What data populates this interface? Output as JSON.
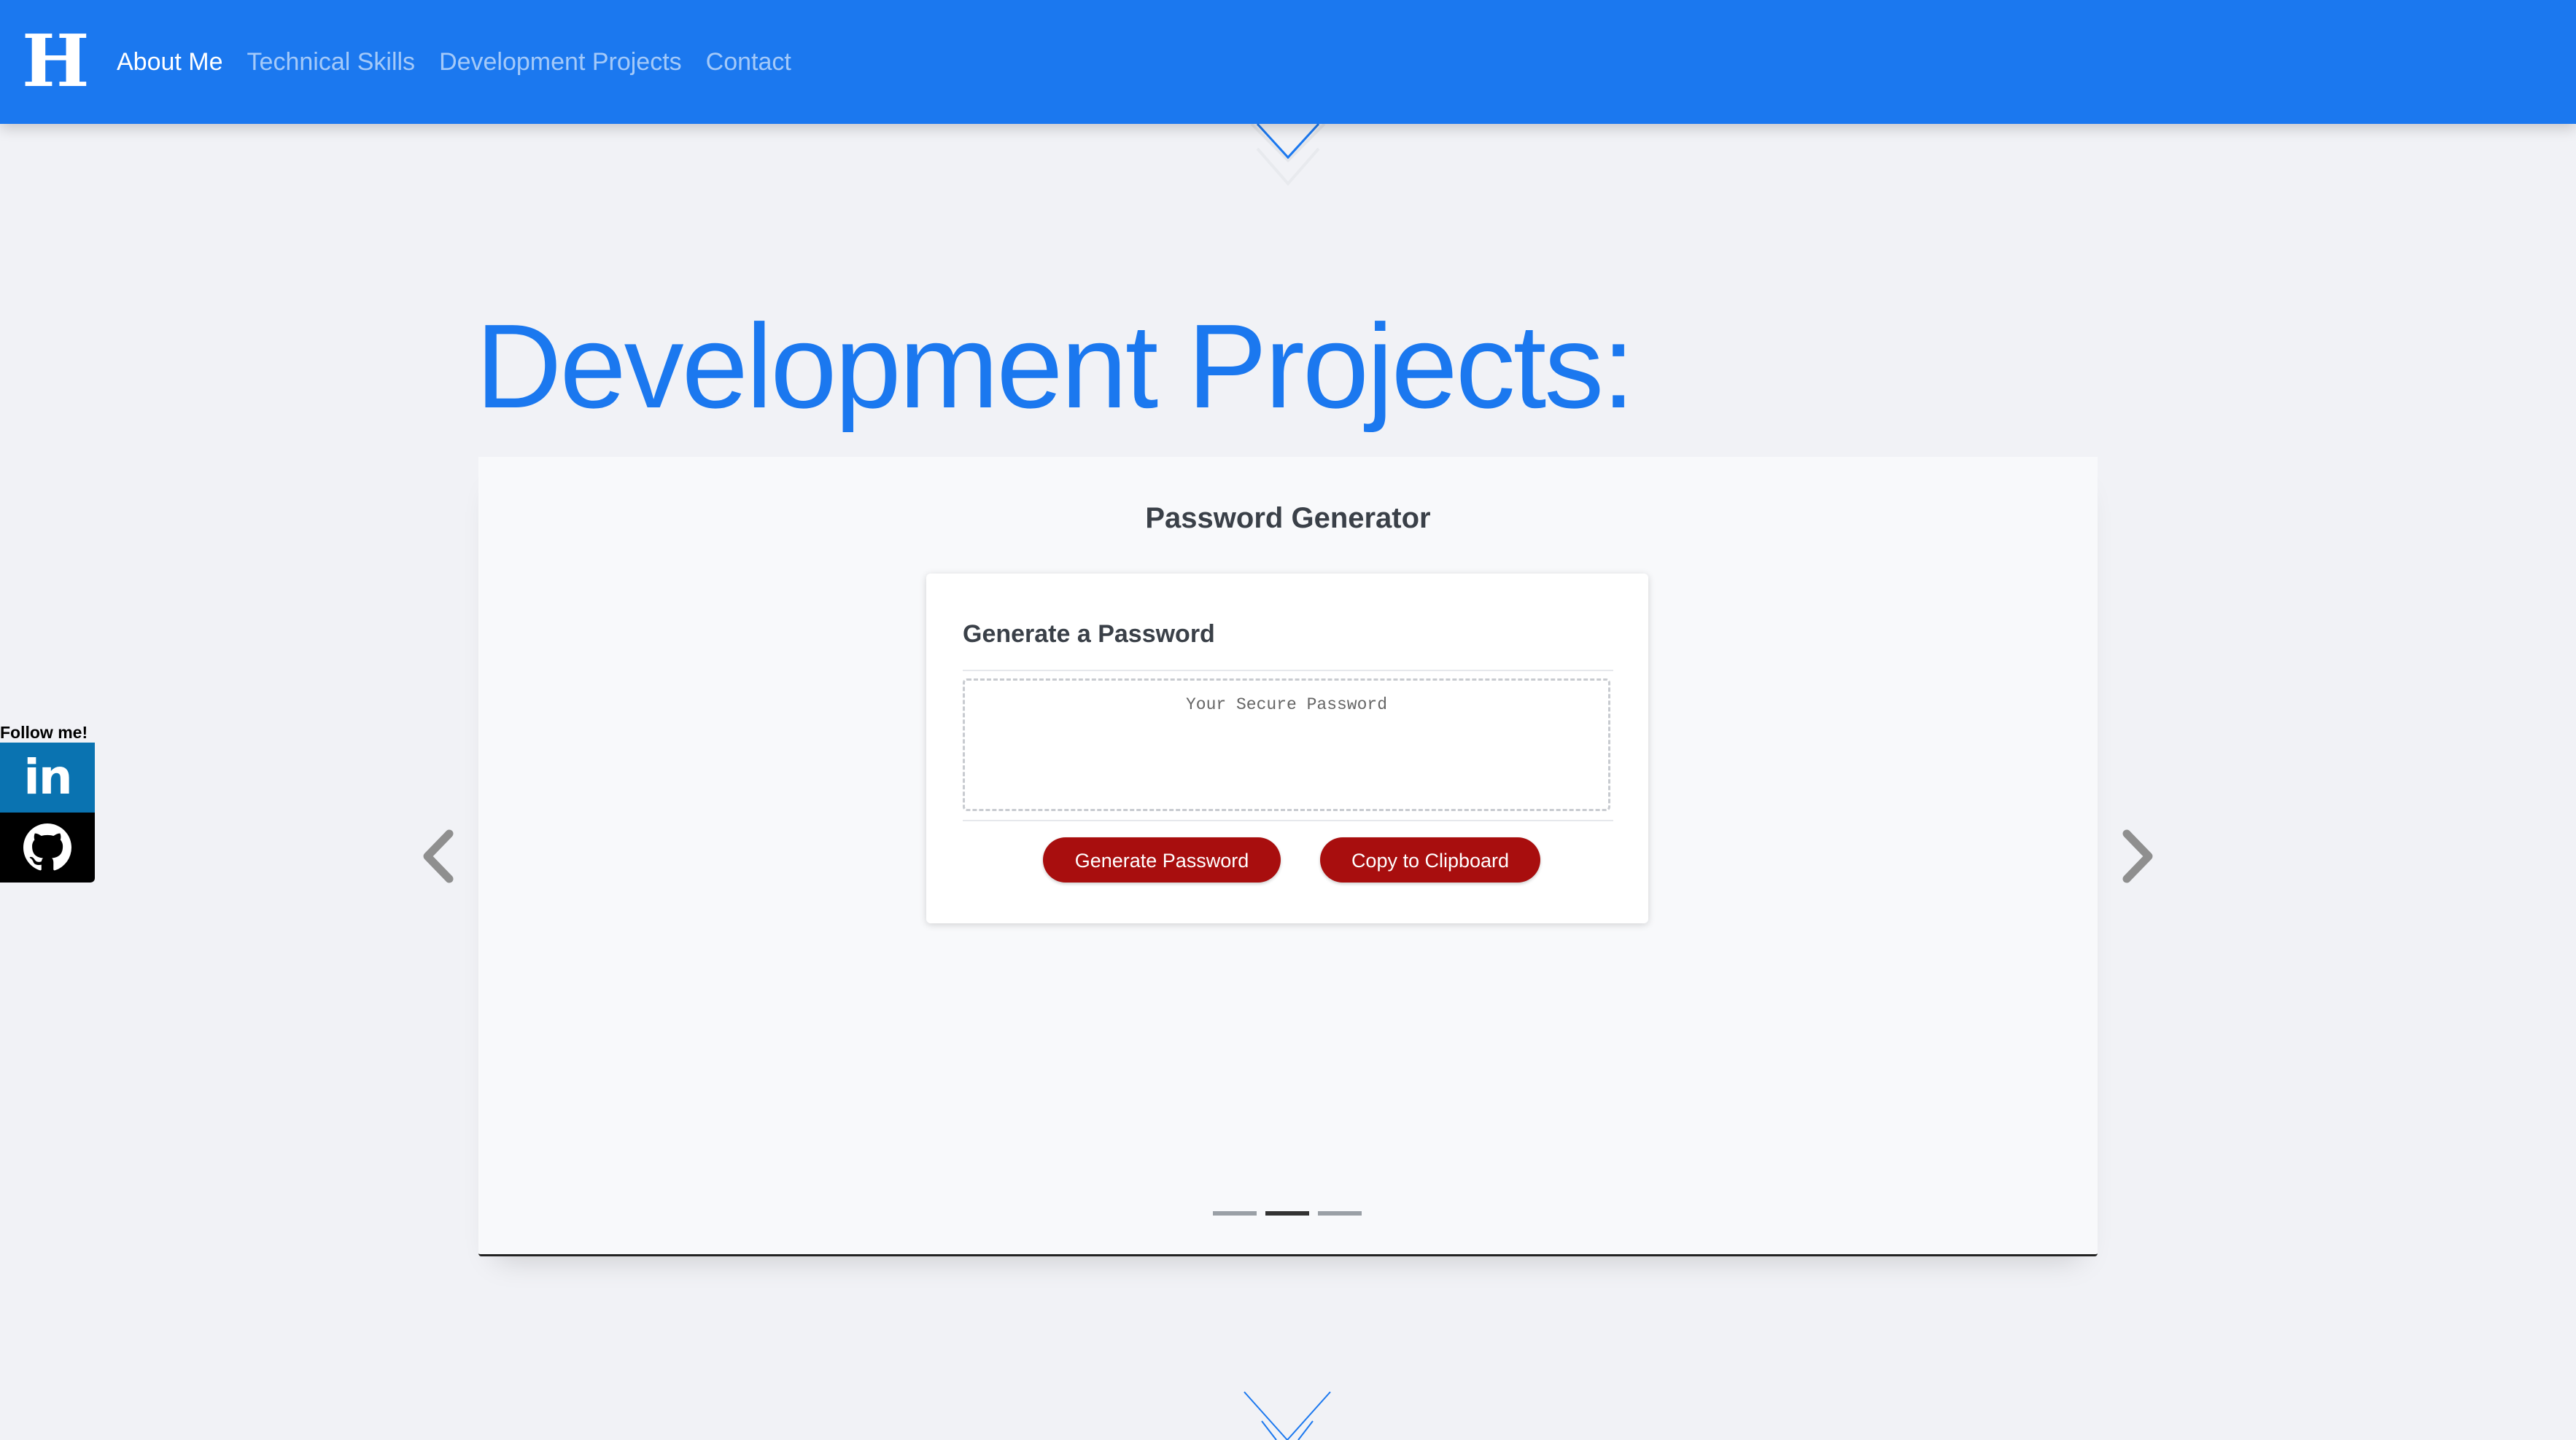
{
  "brand": {
    "logo_letter": "H"
  },
  "nav": {
    "items": [
      {
        "label": "About Me",
        "active": true
      },
      {
        "label": "Technical Skills",
        "active": false
      },
      {
        "label": "Development Projects",
        "active": false
      },
      {
        "label": "Contact",
        "active": false
      }
    ]
  },
  "section": {
    "title": "Development Projects:"
  },
  "carousel": {
    "slide_title": "Password Generator",
    "card": {
      "header": "Generate a Password",
      "password_placeholder": "Your Secure Password",
      "generate_label": "Generate Password",
      "copy_label": "Copy to Clipboard"
    },
    "slide_count": 3,
    "active_slide": 2
  },
  "follow": {
    "label": "Follow me!",
    "links": [
      "linkedin-icon",
      "github-icon"
    ]
  },
  "colors": {
    "primary": "#1b78ef",
    "button": "#a80e0e",
    "linkedin": "#0a73b1",
    "github": "#000000",
    "page_bg": "#f1f2f6"
  }
}
